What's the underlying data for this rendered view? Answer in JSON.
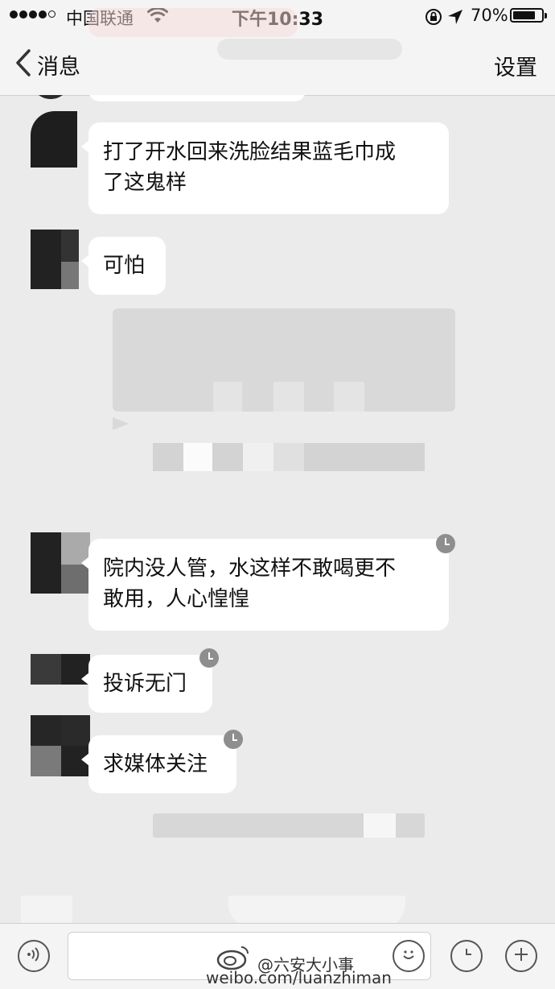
{
  "status_bar": {
    "carrier": "中国联通",
    "time": "下午10:33",
    "battery": "70%",
    "battery_level": 0.7
  },
  "nav": {
    "back_label": "消息",
    "settings_label": "设置"
  },
  "messages": [
    {
      "line1": "打了开水回来洗脸结果蓝毛巾成",
      "line2": "了这鬼样"
    },
    {
      "text": "可怕"
    },
    {
      "line1": "院内没人管，水这样不敢喝更不",
      "line2": "敢用，人心惶惶",
      "pending": true
    },
    {
      "text": "投诉无门",
      "pending": true
    },
    {
      "text": "求媒体关注",
      "pending": true
    }
  ],
  "watermark": {
    "line1": "@六安大小事",
    "line2": "weibo.com/luanzhiman"
  },
  "icons": {
    "back": "chevron-left-icon",
    "voice": "voice-icon",
    "emoji": "emoji-icon",
    "clock": "clock-icon",
    "plus": "plus-icon",
    "pending": "pending-clock-icon"
  }
}
